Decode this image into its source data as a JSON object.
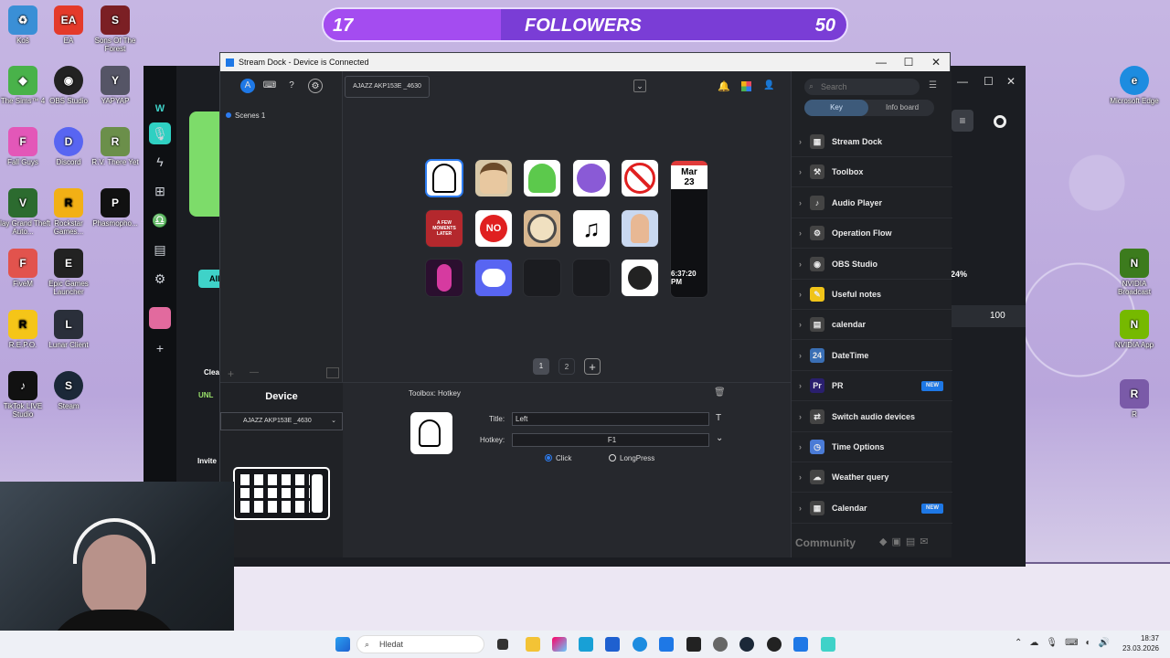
{
  "overlay": {
    "followers_current": "17",
    "followers_label": "FOLLOWERS",
    "followers_goal": "50",
    "progress_fraction": 0.34
  },
  "desktop_icons": [
    {
      "label": "Koš",
      "color": "#3a8fd6",
      "glyph": "♻"
    },
    {
      "label": "EA",
      "color": "#e43a2a",
      "glyph": "EA"
    },
    {
      "label": "Sons Of The Forest",
      "color": "#7b1f24",
      "glyph": "S"
    },
    {
      "label": "The Sims™ 4",
      "color": "#49b24a",
      "glyph": "◆"
    },
    {
      "label": "OBS Studio",
      "color": "#222",
      "glyph": "◉"
    },
    {
      "label": "YAPYAP",
      "color": "#556",
      "glyph": "Y"
    },
    {
      "label": "Fall Guys",
      "color": "#e357b8",
      "glyph": "F"
    },
    {
      "label": "Discord",
      "color": "#5865f2",
      "glyph": "D"
    },
    {
      "label": "R.V. There Yet",
      "color": "#6b8f4a",
      "glyph": "R"
    },
    {
      "label": "Play Grand Theft Auto...",
      "color": "#2c6b2f",
      "glyph": "V"
    },
    {
      "label": "Rockstar Games...",
      "color": "#f2b015",
      "glyph": "R"
    },
    {
      "label": "Phasmopho...",
      "color": "#111",
      "glyph": "P"
    },
    {
      "label": "FiveM",
      "color": "#e2534d",
      "glyph": "F"
    },
    {
      "label": "Epic Games Launcher",
      "color": "#222",
      "glyph": "E"
    },
    {
      "label": "R.E.P.O.",
      "color": "#f5c518",
      "glyph": "R"
    },
    {
      "label": "Lunar Client",
      "color": "#2a2f3a",
      "glyph": "L"
    },
    {
      "label": "TikTok LIVE Studio",
      "color": "#111",
      "glyph": "♪"
    },
    {
      "label": "Steam",
      "color": "#1b2838",
      "glyph": "S"
    },
    {
      "label": "Microsoft Edge",
      "color": "#1d8ce0",
      "glyph": "e"
    },
    {
      "label": "NVIDIA Broadcast",
      "color": "#3c7b1d",
      "glyph": "N"
    },
    {
      "label": "NVIDIA App",
      "color": "#76b900",
      "glyph": "N"
    },
    {
      "label": "R",
      "color": "#7a5aa8",
      "glyph": "R"
    }
  ],
  "window": {
    "title": "Stream Dock - Device is Connected",
    "minimize": "—",
    "maximize": "☐",
    "close": "✕"
  },
  "toolbar": {
    "device_selector": "AJAZZ AKP153E _4630"
  },
  "scenes": {
    "item": "Scenes 1",
    "add": "+",
    "remove": "—"
  },
  "device_panel": {
    "label": "Device",
    "selector": "AJAZZ AKP153E _4630"
  },
  "keys": [
    {
      "label": "",
      "kind": "hotkey-head",
      "bg": "#ffffff"
    },
    {
      "label": "",
      "kind": "meme-old-man",
      "bg": "#d8c8a8"
    },
    {
      "label": "",
      "kind": "broccoli",
      "bg": "#ffffff"
    },
    {
      "label": "",
      "kind": "purple-face",
      "bg": "#ffffff"
    },
    {
      "label": "",
      "kind": "no-sign",
      "bg": "#ffffff"
    },
    {
      "label": "A FEW MOMENTS LATER",
      "kind": "text-red",
      "bg": "#b4282d"
    },
    {
      "label": "NO",
      "kind": "no-button",
      "bg": "#ffffff"
    },
    {
      "label": "",
      "kind": "ramen",
      "bg": "#d9b890"
    },
    {
      "label": "♫",
      "kind": "music",
      "bg": "#ffffff"
    },
    {
      "label": "",
      "kind": "hands",
      "bg": "#c9d8f0"
    },
    {
      "label": "",
      "kind": "pink-figure",
      "bg": "#2b0f2f"
    },
    {
      "label": "",
      "kind": "discord",
      "bg": "#5865f2"
    },
    {
      "label": "",
      "kind": "empty",
      "bg": "#1b1c20"
    },
    {
      "label": "",
      "kind": "empty",
      "bg": "#1b1c20"
    },
    {
      "label": "",
      "kind": "obs",
      "bg": "#ffffff"
    }
  ],
  "calendar_key": {
    "month": "Mar",
    "day": "23",
    "time": "6:37:20 PM"
  },
  "pages": {
    "p1": "1",
    "p2": "2",
    "add": "+"
  },
  "editor": {
    "header": "Toolbox: Hotkey",
    "title_label": "Title:",
    "title_value": "Left",
    "hotkey_label": "Hotkey:",
    "hotkey_value": "F1",
    "mode_click": "Click",
    "mode_longpress": "LongPress",
    "selected_mode": "Click"
  },
  "right_panel": {
    "search_placeholder": "Search",
    "tab_key": "Key",
    "tab_info": "Info board",
    "plugins": [
      {
        "name": "Stream Dock",
        "color": "#444",
        "glyph": "▦",
        "new": ""
      },
      {
        "name": "Toolbox",
        "color": "#444",
        "glyph": "⚒",
        "new": ""
      },
      {
        "name": "Audio Player",
        "color": "#444",
        "glyph": "♪",
        "new": ""
      },
      {
        "name": "Operation Flow",
        "color": "#444",
        "glyph": "⚙",
        "new": ""
      },
      {
        "name": "OBS Studio",
        "color": "#444",
        "glyph": "◉",
        "new": ""
      },
      {
        "name": "Useful notes",
        "color": "#f0c419",
        "glyph": "✎",
        "new": ""
      },
      {
        "name": "calendar",
        "color": "#444",
        "glyph": "▤",
        "new": ""
      },
      {
        "name": "DateTime",
        "color": "#3a6fb5",
        "glyph": "24",
        "new": ""
      },
      {
        "name": "PR",
        "color": "#2a1f6e",
        "glyph": "Pr",
        "new": "NEW"
      },
      {
        "name": "Switch audio devices",
        "color": "#444",
        "glyph": "⇄",
        "new": ""
      },
      {
        "name": "Time Options",
        "color": "#4a7bd6",
        "glyph": "◷",
        "new": ""
      },
      {
        "name": "Weather query",
        "color": "#444",
        "glyph": "☁",
        "new": ""
      },
      {
        "name": "Calendar",
        "color": "#444",
        "glyph": "▦",
        "new": "NEW"
      }
    ],
    "community": "Community"
  },
  "back_app": {
    "percent": "24%",
    "value": "100",
    "button_all": "All",
    "label_clean": "Clea",
    "label_invite": "Invite",
    "label_unl": "UNL"
  },
  "taskbar": {
    "search_placeholder": "Hledat",
    "time": "18:37",
    "date": "23.03.2026"
  }
}
